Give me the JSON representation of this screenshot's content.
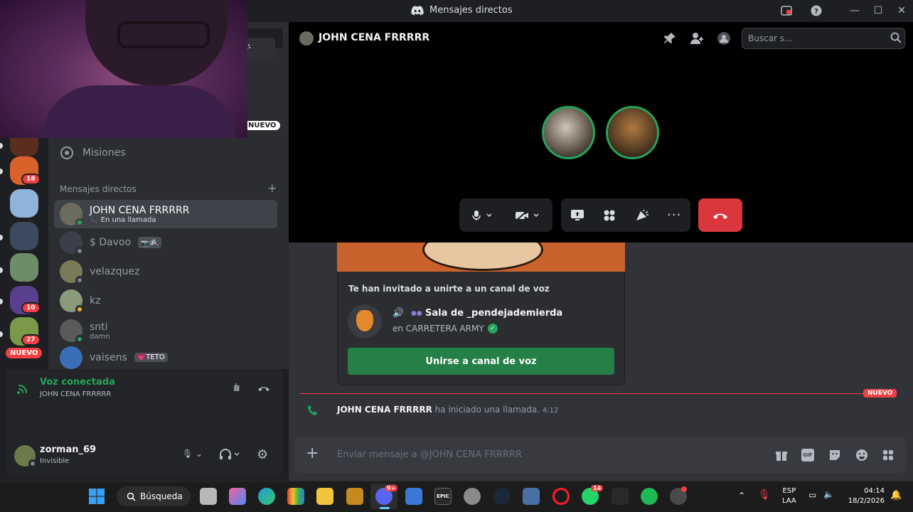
{
  "window": {
    "title": "Mensajes directos"
  },
  "sidebar": {
    "new_badge": "NUEVO",
    "missions": "Misiones",
    "dm_header": "Mensajes directos",
    "dms": [
      {
        "name": "JOHN CENA FRRRRR",
        "sub": "En una llamada",
        "active": true
      },
      {
        "name": "$ Davoo",
        "sub": "",
        "tag": "📷ॐ."
      },
      {
        "name": "velazquez",
        "sub": ""
      },
      {
        "name": "kz",
        "sub": ""
      },
      {
        "name": "snti",
        "sub": "damn"
      },
      {
        "name": "vaisens",
        "sub": "",
        "tag": "💗TETO"
      }
    ]
  },
  "rail": {
    "badges": [
      "18",
      "10",
      "27"
    ],
    "new_label": "NUEVO"
  },
  "voice": {
    "status": "Voz conectada",
    "channel": "JOHN CENA FRRRRR"
  },
  "user": {
    "name": "zorman_69",
    "status": "Invisible"
  },
  "header": {
    "name": "JOHN CENA FRRRRR",
    "search_placeholder": "Buscar s..."
  },
  "invite": {
    "heading": "Te han invitado a unirte a un canal de voz",
    "channel": "Sala de _pendejademierda",
    "server": "en CARRETERA ARMY",
    "join": "Unirse a canal de voz"
  },
  "divider": {
    "label": "NUEVO"
  },
  "call_msg": {
    "author": "JOHN CENA FRRRRR",
    "text": "ha iniciado una llamada.",
    "time": "4:12"
  },
  "composer": {
    "placeholder": "Enviar mensaje a @JOHN CENA FRRRRR"
  },
  "taskbar": {
    "search": "Búsqueda",
    "lang1": "ESP",
    "lang2": "LAA",
    "time": "04:14",
    "date": "18/2/2026",
    "discord_badge": "9+",
    "whatsapp_badge": "14"
  },
  "colors": {
    "accent_green": "#23a55a",
    "hangup_red": "#da373c",
    "brand": "#5865f2"
  }
}
